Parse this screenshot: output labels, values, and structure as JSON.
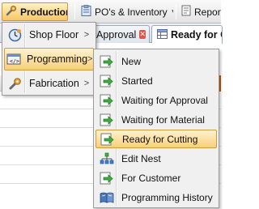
{
  "toolbar": {
    "production_label": "Production",
    "pos_inventory_label": "PO's & Inventory",
    "reports_label": "Reports"
  },
  "tabs": [
    {
      "label": "Approval",
      "closable": true
    },
    {
      "label": "Ready for C",
      "current": true
    }
  ],
  "production_menu": {
    "items": [
      {
        "label": "Shop Floor",
        "icon": "clock-icon",
        "has_submenu": true
      },
      {
        "label": "Programming",
        "icon": "code-window-icon",
        "has_submenu": true,
        "highlighted": true
      },
      {
        "label": "Fabrication",
        "icon": "wrench-icon",
        "has_submenu": true
      }
    ]
  },
  "programming_submenu": {
    "items": [
      {
        "label": "New",
        "icon": "green-arrow-doc-icon"
      },
      {
        "label": "Started",
        "icon": "green-arrow-doc-icon"
      },
      {
        "label": "Waiting for Approval",
        "icon": "green-arrow-doc-icon"
      },
      {
        "label": "Waiting for Material",
        "icon": "green-arrow-doc-icon"
      },
      {
        "label": "Ready for Cutting",
        "icon": "green-arrow-doc-icon",
        "highlighted": true
      },
      {
        "label": "Edit Nest",
        "icon": "nest-tree-icon"
      },
      {
        "label": "For Customer",
        "icon": "green-arrow-doc-icon"
      },
      {
        "label": "Programming History",
        "icon": "book-icon"
      }
    ]
  },
  "colors": {
    "highlight_top": "#fff3cf",
    "highlight_bottom": "#f8cf7a",
    "highlight_border": "#d29b3c",
    "menu_bg": "#f0f0f0"
  }
}
